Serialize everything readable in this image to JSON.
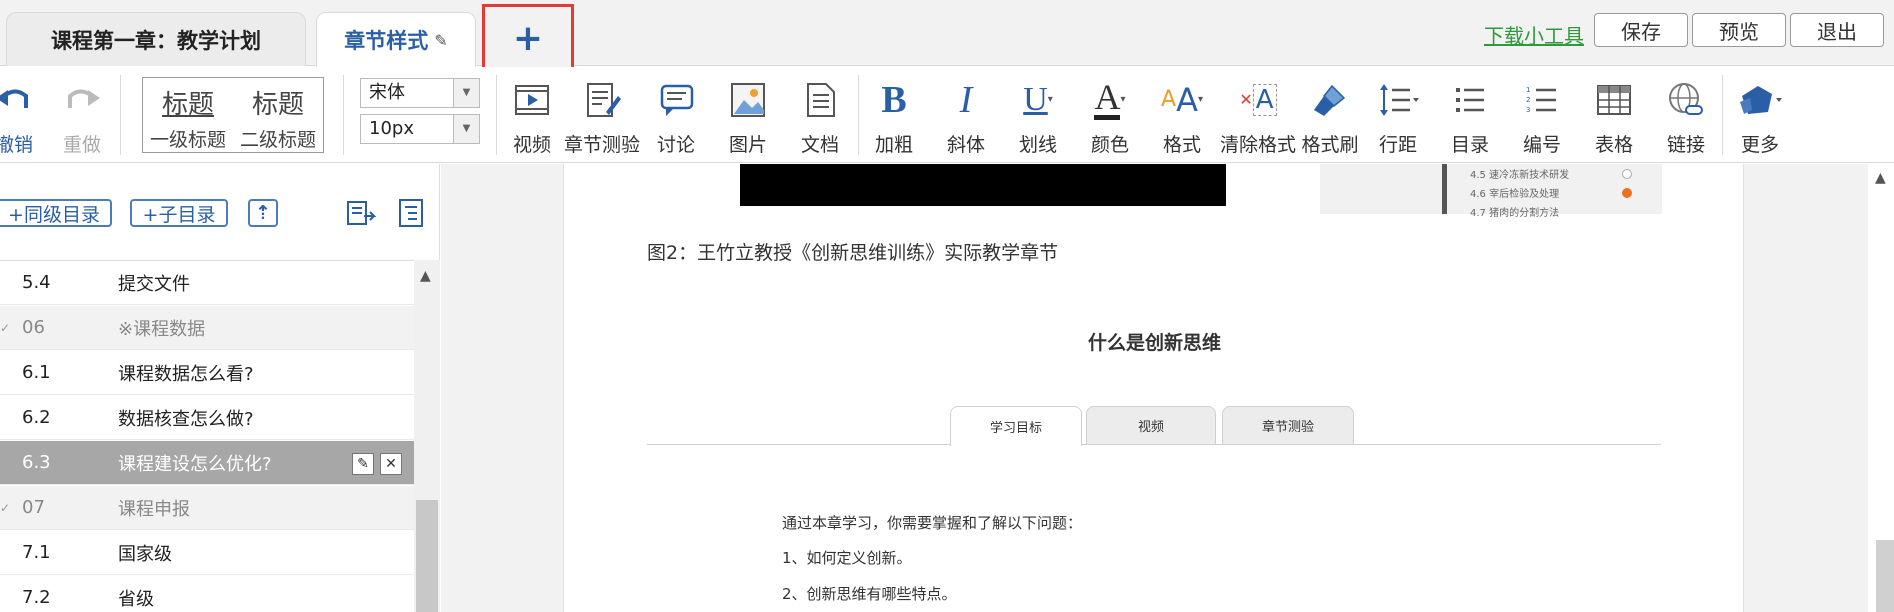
{
  "tabs": {
    "tab1_label": "课程第一章：教学计划",
    "tab2_label": "章节样式",
    "add_label": "+"
  },
  "header_actions": {
    "download_tool": "下载小工具",
    "save": "保存",
    "preview": "预览",
    "exit": "退出"
  },
  "toolbar": {
    "undo": "撤销",
    "redo": "重做",
    "heading1_big": "标题",
    "heading1_small": "一级标题",
    "heading2_big": "标题",
    "heading2_small": "二级标题",
    "font": "宋体",
    "size": "10px",
    "video": "视频",
    "quiz": "章节测验",
    "discuss": "讨论",
    "image": "图片",
    "doc": "文档",
    "bold": "加粗",
    "italic": "斜体",
    "underline": "划线",
    "color": "颜色",
    "format": "格式",
    "clear_format": "清除格式",
    "format_brush": "格式刷",
    "line_height": "行距",
    "toc": "目录",
    "numbering": "编号",
    "table": "表格",
    "link": "链接",
    "more": "更多"
  },
  "sidebar": {
    "add_sibling": "+同级目录",
    "add_child": "+子目录",
    "move_up": "⇡",
    "rows": [
      {
        "num": "5.4",
        "title": "提交文件",
        "type": "item"
      },
      {
        "num": "06",
        "title": "※课程数据",
        "type": "section"
      },
      {
        "num": "6.1",
        "title": "课程数据怎么看?",
        "type": "item"
      },
      {
        "num": "6.2",
        "title": "数据核查怎么做?",
        "type": "item"
      },
      {
        "num": "6.3",
        "title": "课程建设怎么优化?",
        "type": "active"
      },
      {
        "num": "07",
        "title": "课程申报",
        "type": "section"
      },
      {
        "num": "7.1",
        "title": "国家级",
        "type": "item"
      },
      {
        "num": "7.2",
        "title": "省级",
        "type": "item"
      }
    ]
  },
  "editor": {
    "thumb_items": [
      "4.5 速冷冻新技术研发",
      "4.6 宰后检验及处理",
      "4.7 猪肉的分割方法"
    ],
    "figure_caption": "图2：王竹立教授《创新思维训练》实际教学章节",
    "doc_title": "什么是创新思维",
    "doc_tabs": [
      "学习目标",
      "视频",
      "章节测验"
    ],
    "body_lines": [
      "通过本章学习，你需要掌握和了解以下问题：",
      "1、如何定义创新。",
      "2、创新思维有哪些特点。"
    ]
  },
  "colors": {
    "accent_blue": "#2a5fa8",
    "highlight_red": "#e53935",
    "link_green": "#2e9a3c",
    "active_row": "#a7a7a7"
  }
}
